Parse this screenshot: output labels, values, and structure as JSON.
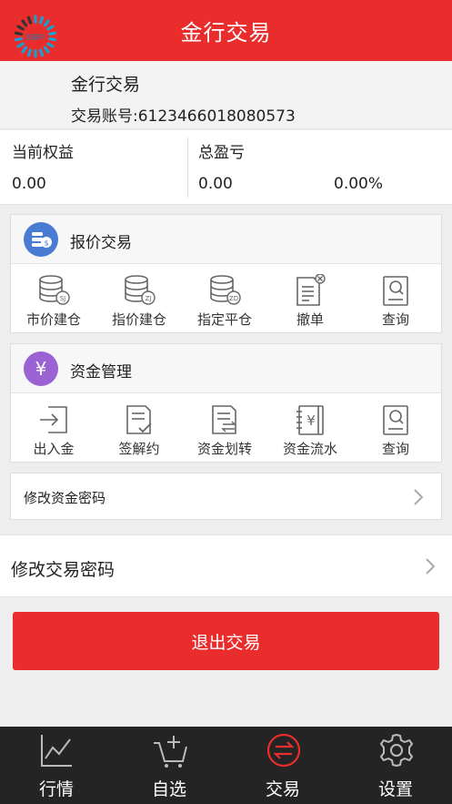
{
  "header": {
    "title": "金行交易"
  },
  "account": {
    "loader_text": "加载中",
    "name": "金行交易",
    "account_no": "交易账号:6123466018080573"
  },
  "stats": {
    "equity_label": "当前权益",
    "equity_value": "0.00",
    "pnl_label": "总盈亏",
    "pnl_value": "0.00",
    "pnl_percent": "0.00%"
  },
  "quote_trade": {
    "title": "报价交易",
    "items": [
      {
        "label": "市价建仓",
        "badge": "SJ",
        "icon": "database-icon"
      },
      {
        "label": "指价建仓",
        "badge": "ZJ",
        "icon": "database-icon"
      },
      {
        "label": "指定平仓",
        "badge": "ZD",
        "icon": "database-icon"
      },
      {
        "label": "撤单",
        "icon": "cancel-order-icon"
      },
      {
        "label": "查询",
        "icon": "query-icon"
      }
    ]
  },
  "fund_mgmt": {
    "title": "资金管理",
    "symbol": "¥",
    "items": [
      {
        "label": "出入金",
        "icon": "login-arrow-icon"
      },
      {
        "label": "签解约",
        "icon": "sign-doc-icon"
      },
      {
        "label": "资金划转",
        "icon": "transfer-doc-icon"
      },
      {
        "label": "资金流水",
        "icon": "ledger-icon"
      },
      {
        "label": "查询",
        "icon": "query-icon"
      }
    ]
  },
  "rows": {
    "change_fund_pwd": "修改资金密码",
    "change_trade_pwd": "修改交易密码"
  },
  "logout_label": "退出交易",
  "tabbar": {
    "items": [
      {
        "label": "行情",
        "icon": "chart-line-icon"
      },
      {
        "label": "自选",
        "icon": "cart-plus-icon"
      },
      {
        "label": "交易",
        "icon": "exchange-icon",
        "active": true
      },
      {
        "label": "设置",
        "icon": "gear-icon"
      }
    ]
  },
  "colors": {
    "brand_red": "#e92d2d",
    "quote_icon_bg": "#4a7bd3",
    "fund_icon_bg": "#9a62d2",
    "tabbar_bg": "#242424"
  }
}
